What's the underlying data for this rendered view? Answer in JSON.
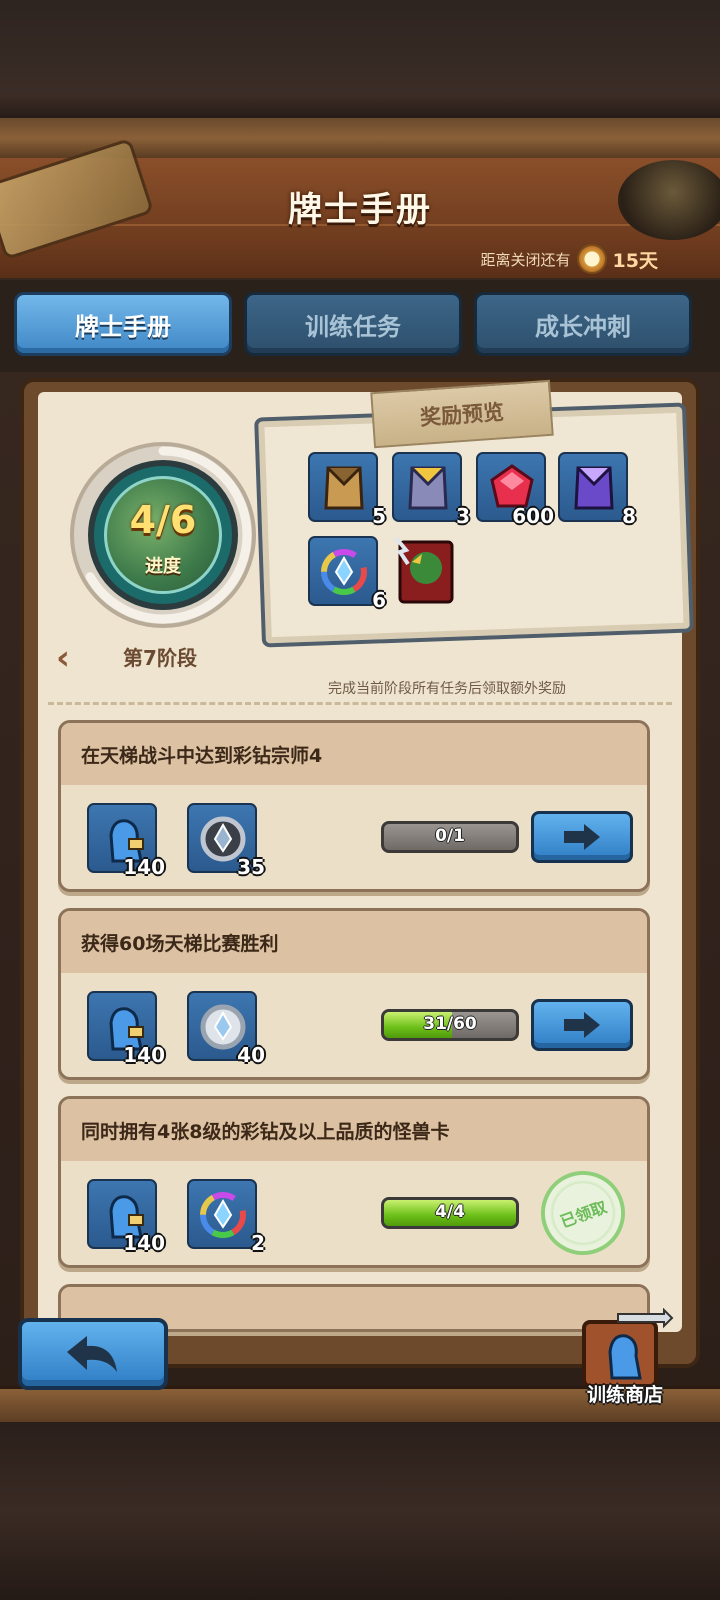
{
  "header": {
    "title": "牌士手册",
    "countdown_label": "距离关闭还有",
    "countdown_value": "15天"
  },
  "tabs": [
    {
      "label": "牌士手册",
      "active": true
    },
    {
      "label": "训练任务",
      "active": false
    },
    {
      "label": "成长冲刺",
      "active": false
    }
  ],
  "stage": {
    "progress_text": "4/6",
    "progress_label": "进度",
    "progress_fraction": 0.667,
    "name": "第7阶段"
  },
  "reward_preview": {
    "title": "奖励预览",
    "items": [
      {
        "icon": "bronze-card-pack-icon",
        "count": "5"
      },
      {
        "icon": "silver-card-pack-icon",
        "count": "3"
      },
      {
        "icon": "red-gem-icon",
        "count": "600"
      },
      {
        "icon": "purple-card-pack-icon",
        "count": "8"
      },
      {
        "icon": "rainbow-diamond-badge-icon",
        "count": "6"
      },
      {
        "icon": "monster-card-icon",
        "count": ""
      }
    ],
    "hint": "完成当前阶段所有任务后领取额外奖励"
  },
  "tasks": [
    {
      "title": "在天梯战斗中达到彩钻宗师4",
      "rewards": [
        {
          "icon": "trainer-xp-icon",
          "count": "140"
        },
        {
          "icon": "dark-diamond-badge-icon",
          "count": "35"
        }
      ],
      "progress_text": "0/1",
      "progress_fraction": 0.0,
      "status": "go"
    },
    {
      "title": "获得60场天梯比赛胜利",
      "rewards": [
        {
          "icon": "trainer-xp-icon",
          "count": "140"
        },
        {
          "icon": "silver-diamond-badge-icon",
          "count": "40"
        }
      ],
      "progress_text": "31/60",
      "progress_fraction": 0.517,
      "status": "go"
    },
    {
      "title": "同时拥有4张8级的彩钻及以上品质的怪兽卡",
      "rewards": [
        {
          "icon": "trainer-xp-icon",
          "count": "140"
        },
        {
          "icon": "rainbow-diamond-badge-icon",
          "count": "2"
        }
      ],
      "progress_text": "4/4",
      "progress_fraction": 1.0,
      "status": "claimed",
      "status_label": "已领取"
    }
  ],
  "bottom": {
    "shop_label": "训练商店"
  },
  "colors": {
    "tab_active": "#4f9bd8",
    "tab_inactive": "#335a7a",
    "progress_green": "#6cbf18",
    "button_blue": "#3f8fd2"
  }
}
